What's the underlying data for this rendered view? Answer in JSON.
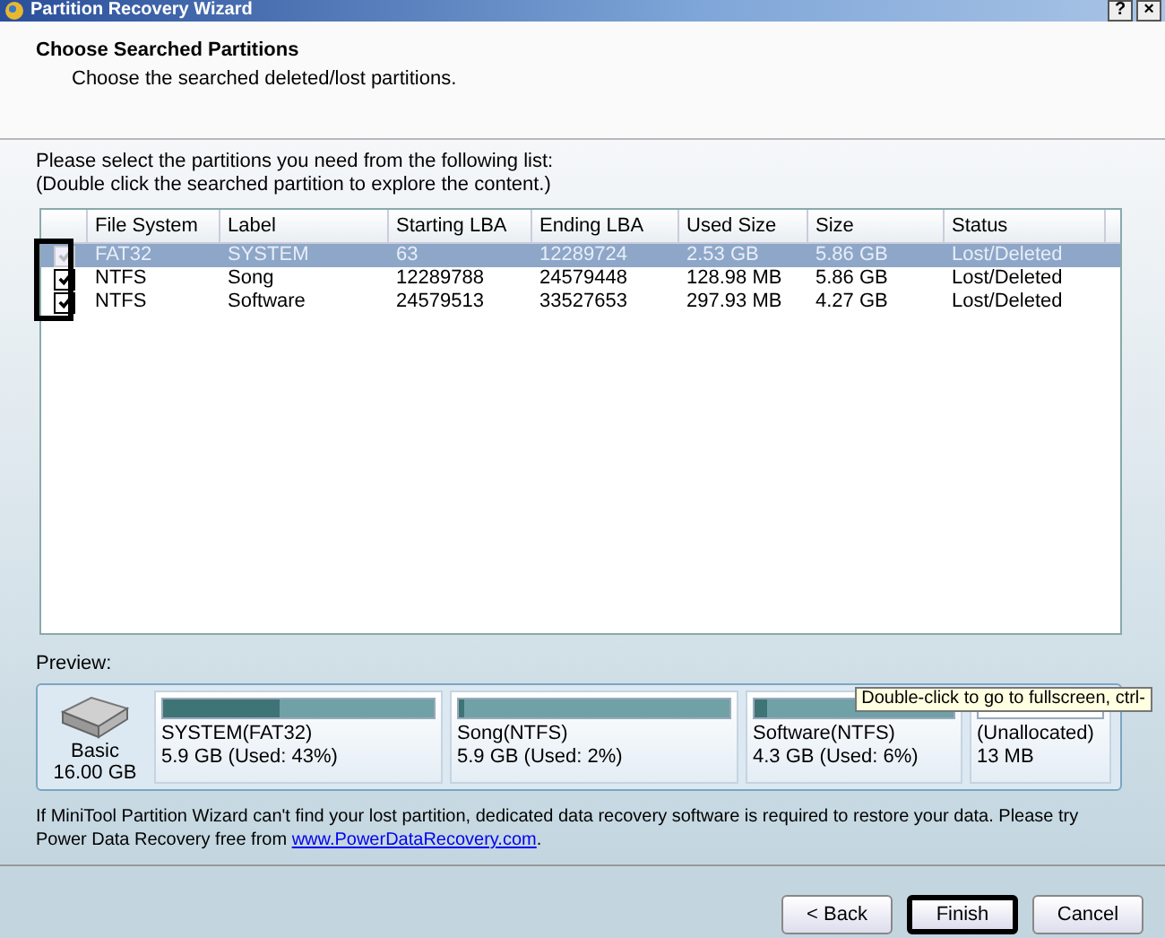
{
  "window": {
    "title": "Partition Recovery Wizard",
    "buttons": [
      "?",
      "×"
    ]
  },
  "header": {
    "title": "Choose Searched Partitions",
    "subtitle": "Choose the searched deleted/lost partitions."
  },
  "instructions": [
    "Please select the partitions you need from the following list:",
    "(Double click the searched partition to explore the content.)"
  ],
  "table": {
    "columns": [
      "File System",
      "Label",
      "Starting LBA",
      "Ending LBA",
      "Used Size",
      "Size",
      "Status"
    ],
    "checkbox_highlight": true,
    "rows": [
      {
        "checked": true,
        "selected": true,
        "cells": [
          "FAT32",
          "SYSTEM",
          "63",
          "12289724",
          "2.53 GB",
          "5.86 GB",
          "Lost/Deleted"
        ]
      },
      {
        "checked": true,
        "selected": false,
        "cells": [
          "NTFS",
          "Song",
          "12289788",
          "24579448",
          "128.98 MB",
          "5.86 GB",
          "Lost/Deleted"
        ]
      },
      {
        "checked": true,
        "selected": false,
        "cells": [
          "NTFS",
          "Software",
          "24579513",
          "33527653",
          "297.93 MB",
          "4.27 GB",
          "Lost/Deleted"
        ]
      }
    ]
  },
  "preview": {
    "label": "Preview:",
    "disk": {
      "name": "Basic",
      "size": "16.00 GB"
    },
    "partitions": [
      {
        "kind": "used",
        "name": "SYSTEM(FAT32)",
        "info": "5.9 GB (Used: 43%)",
        "level": 0.43
      },
      {
        "kind": "used",
        "name": "Song(NTFS)",
        "info": "5.9 GB (Used: 2%)",
        "level": 0.02
      },
      {
        "kind": "used",
        "name": "Software(NTFS)",
        "info": "4.3 GB (Used: 6%)",
        "level": 0.06
      },
      {
        "kind": "unallocated",
        "name": "(Unallocated)",
        "info": "13 MB"
      }
    ]
  },
  "tooltip": "Double-click to go to fullscreen, ctrl-",
  "note": {
    "text": "If MiniTool Partition Wizard can't find your lost partition, dedicated data recovery software is required to restore your data. Please try Power Data Recovery free from",
    "link": "www.PowerDataRecovery.com",
    "end": "."
  },
  "buttons": [
    {
      "label": "< Back",
      "highlighted": false
    },
    {
      "label": "Finish",
      "highlighted": true
    },
    {
      "label": "Cancel",
      "highlighted": false
    }
  ]
}
